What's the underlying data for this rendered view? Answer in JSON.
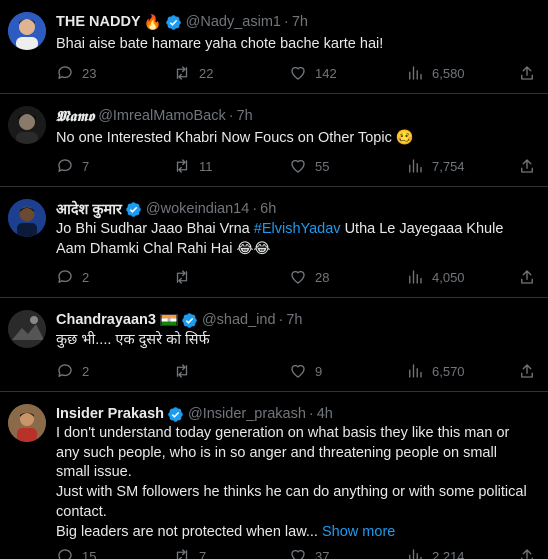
{
  "colors": {
    "background": "#000000",
    "text": "#e7e9ea",
    "muted": "#71767b",
    "accent": "#1d9bf0",
    "border": "#2f3336"
  },
  "tweets": [
    {
      "name": "THE NADDY",
      "name_emoji": "🔥",
      "handle": "@Nady_asim1",
      "time": "7h",
      "text": "Bhai aise bate hamare yaha chote bache karte hai!",
      "replies": "23",
      "retweets": "22",
      "likes": "142",
      "views": "6,580"
    },
    {
      "name": "𝕸𝖆𝖒𝖔",
      "handle": "@ImrealMamoBack",
      "time": "7h",
      "text": "No one Interested Khabri Now Foucs on Other Topic 🥴",
      "replies": "7",
      "retweets": "11",
      "likes": "55",
      "views": "7,754"
    },
    {
      "name": "आदेश कुमार",
      "handle": "@wokeindian14",
      "time": "6h",
      "text_before": "Jo Bhi Sudhar Jaao Bhai Vrna ",
      "hashtag": "#ElvishYadav",
      "text_after": " Utha Le Jayegaaa Khule Aam Dhamki Chal Rahi Hai 😂😂",
      "replies": "2",
      "retweets": "",
      "likes": "28",
      "views": "4,050"
    },
    {
      "name": "Chandrayaan3",
      "handle": "@shad_ind",
      "time": "7h",
      "text": "कुछ भी.... एक दुसरे को सिर्फ",
      "replies": "2",
      "retweets": "",
      "likes": "9",
      "views": "6,570"
    },
    {
      "name": "Insider Prakash",
      "handle": "@Insider_prakash",
      "time": "4h",
      "text_line1": "I don't understand today generation on what basis they like this man or any such people, who is in so anger and threatening people on small small issue.",
      "text_line2": "Just with SM followers he thinks he can do anything or with some political contact.",
      "text_line3": "Big leaders are not protected when law...",
      "show_more": "Show more",
      "replies": "15",
      "retweets": "7",
      "likes": "37",
      "views": "2,214"
    }
  ]
}
